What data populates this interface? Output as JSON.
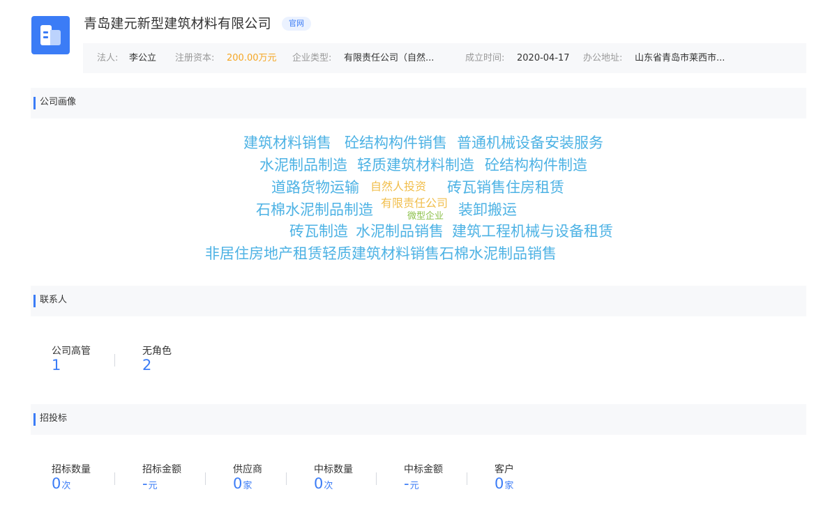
{
  "header": {
    "company_name": "青岛建元新型建筑材料有限公司",
    "badge": "官网"
  },
  "info": {
    "legal_label": "法人:",
    "legal_value": "李公立",
    "capital_label": "注册资本:",
    "capital_value": "200.00万元",
    "type_label": "企业类型:",
    "type_value": "有限责任公司（自然...",
    "founded_label": "成立时间:",
    "founded_value": "2020-04-17",
    "address_label": "办公地址:",
    "address_value": "山东省青岛市莱西市..."
  },
  "profile": {
    "title": "公司画像",
    "tags": [
      "建筑材料销售",
      "砼结构构件销售",
      "普通机械设备安装服务",
      "水泥制品制造",
      "轻质建筑材料制造",
      "砼结构构件制造",
      "道路货物运输",
      "自然人投资",
      "砖瓦销售住房租赁",
      "石棉水泥制品制造",
      "有限责任公司",
      "微型企业",
      "装卸搬运",
      "砖瓦制造",
      "水泥制品销售",
      "建筑工程机械与设备租赁",
      "非居住房地产租赁轻质建筑材料销售石棉水泥制品销售"
    ]
  },
  "contacts": {
    "title": "联系人",
    "stats": [
      {
        "label": "公司高管",
        "value": "1"
      },
      {
        "label": "无角色",
        "value": "2"
      }
    ]
  },
  "bidding": {
    "title": "招投标",
    "stats": [
      {
        "label": "招标数量",
        "value": "0",
        "unit": "次"
      },
      {
        "label": "招标金额",
        "value": "-",
        "unit": "元"
      },
      {
        "label": "供应商",
        "value": "0",
        "unit": "家"
      },
      {
        "label": "中标数量",
        "value": "0",
        "unit": "次"
      },
      {
        "label": "中标金额",
        "value": "-",
        "unit": "元"
      },
      {
        "label": "客户",
        "value": "0",
        "unit": "家"
      }
    ]
  },
  "colors": {
    "accent": "#3b7cf6",
    "tag_blue": "#4db2e4",
    "tag_orange": "#f1be4b",
    "tag_green": "#8cc04a",
    "capital_orange": "#f5a623"
  }
}
